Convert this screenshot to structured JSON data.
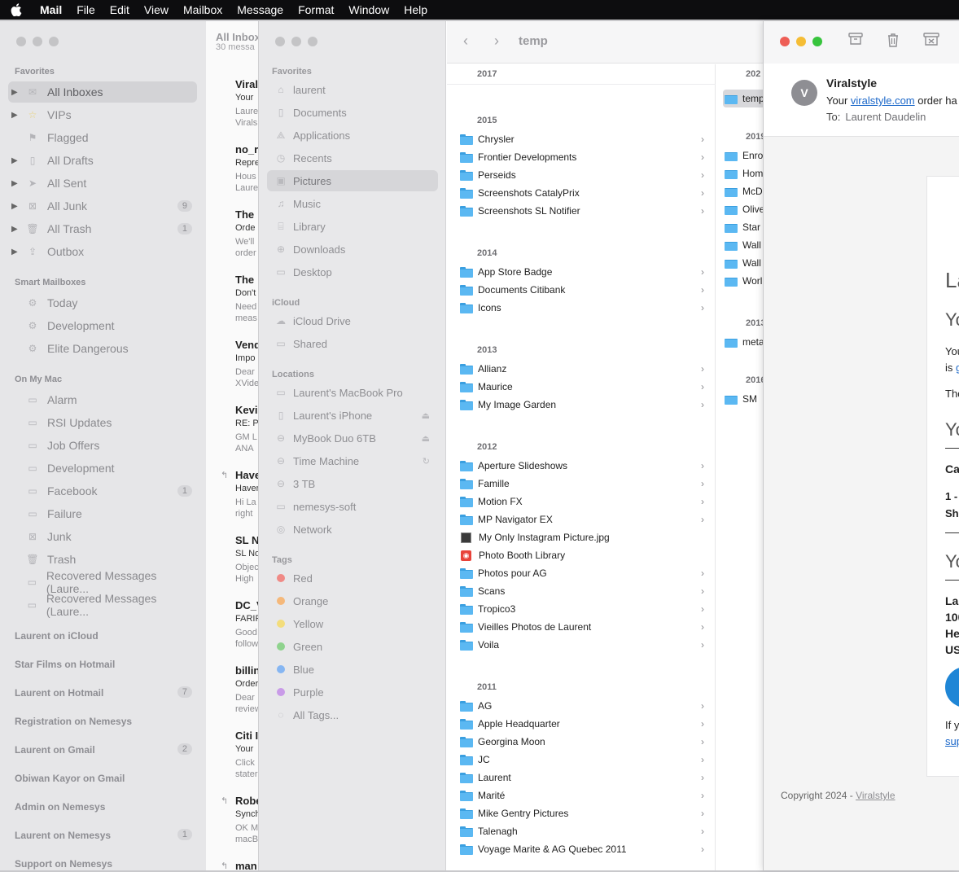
{
  "menubar": {
    "app": "Mail",
    "items": [
      "File",
      "Edit",
      "View",
      "Mailbox",
      "Message",
      "Format",
      "Window",
      "Help"
    ]
  },
  "mail_sidebar": {
    "favorites_title": "Favorites",
    "favorites": [
      {
        "label": "All Inboxes",
        "badge": ""
      },
      {
        "label": "VIPs",
        "badge": ""
      },
      {
        "label": "Flagged",
        "badge": ""
      },
      {
        "label": "All Drafts",
        "badge": ""
      },
      {
        "label": "All Sent",
        "badge": ""
      },
      {
        "label": "All Junk",
        "badge": "9"
      },
      {
        "label": "All Trash",
        "badge": "1"
      },
      {
        "label": "Outbox",
        "badge": ""
      }
    ],
    "smart_title": "Smart Mailboxes",
    "smart": [
      "Today",
      "Development",
      "Elite Dangerous"
    ],
    "onmymac_title": "On My Mac",
    "onmymac": [
      {
        "label": "Alarm",
        "badge": ""
      },
      {
        "label": "RSI Updates",
        "badge": ""
      },
      {
        "label": "Job Offers",
        "badge": ""
      },
      {
        "label": "Development",
        "badge": ""
      },
      {
        "label": "Facebook",
        "badge": "1"
      },
      {
        "label": "Failure",
        "badge": ""
      },
      {
        "label": "Junk",
        "badge": ""
      },
      {
        "label": "Trash",
        "badge": ""
      },
      {
        "label": "Recovered Messages (Laure...",
        "badge": ""
      },
      {
        "label": "Recovered Messages (Laure...",
        "badge": ""
      }
    ],
    "accounts": [
      {
        "label": "Laurent on iCloud",
        "badge": ""
      },
      {
        "label": "Star Films on Hotmail",
        "badge": ""
      },
      {
        "label": "Laurent on Hotmail",
        "badge": "7"
      },
      {
        "label": "Registration on Nemesys",
        "badge": ""
      },
      {
        "label": "Laurent on Gmail",
        "badge": "2"
      },
      {
        "label": "Obiwan Kayor on Gmail",
        "badge": ""
      },
      {
        "label": "Admin on Nemesys",
        "badge": ""
      },
      {
        "label": "Laurent on Nemesys",
        "badge": "1"
      },
      {
        "label": "Support on Nemesys",
        "badge": ""
      }
    ]
  },
  "message_list": {
    "title": "All Inbox",
    "subtitle": "30 messa",
    "messages": [
      {
        "from": "Viral",
        "l2": "Your",
        "l3a": "Laure",
        "l3b": "Virals"
      },
      {
        "from": "no_r",
        "l2": "Repre",
        "l3a": "Hous",
        "l3b": "Laure"
      },
      {
        "from": "The",
        "l2": "Orde",
        "l3a": "We'll",
        "l3b": "order"
      },
      {
        "from": "The",
        "l2": "Don't",
        "l3a": "Need",
        "l3b": "meas"
      },
      {
        "from": "Vend",
        "l2": "Impo",
        "l3a": "Dear",
        "l3b": "XVide"
      },
      {
        "from": "Kevi",
        "l2": "RE: P",
        "l3a": "GM L",
        "l3b": "ANA"
      },
      {
        "from": "Have",
        "l2": "Haver",
        "l3a": "Hi La",
        "l3b": "right"
      },
      {
        "from": "SL N",
        "l2": "SL No",
        "l3a": "Objec",
        "l3b": "High"
      },
      {
        "from": "DC_V",
        "l2": "FARIF",
        "l3a": "Good",
        "l3b": "follow"
      },
      {
        "from": "billin",
        "l2": "Order",
        "l3a": "Dear",
        "l3b": "review"
      },
      {
        "from": "Citi I",
        "l2": "Your",
        "l3a": "Click",
        "l3b": "stater"
      },
      {
        "from": "Robe",
        "l2": "Synch",
        "l3a": "OK M",
        "l3b": "macB"
      },
      {
        "from": "man",
        "l2": "",
        "l3a": "",
        "l3b": ""
      }
    ]
  },
  "finder": {
    "path": "temp",
    "favorites_title": "Favorites",
    "favorites": [
      "laurent",
      "Documents",
      "Applications",
      "Recents",
      "Pictures",
      "Music",
      "Library",
      "Downloads",
      "Desktop"
    ],
    "icloud_title": "iCloud",
    "icloud": [
      "iCloud Drive",
      "Shared"
    ],
    "locations_title": "Locations",
    "locations": [
      "Laurent's MacBook Pro",
      "Laurent's iPhone",
      "MyBook Duo 6TB",
      "Time Machine",
      "3 TB",
      "nemesys-soft",
      "Network"
    ],
    "tags_title": "Tags",
    "tags": [
      {
        "label": "Red",
        "color": "#f08a86"
      },
      {
        "label": "Orange",
        "color": "#f5b87a"
      },
      {
        "label": "Yellow",
        "color": "#f3dd7c"
      },
      {
        "label": "Green",
        "color": "#8fd38e"
      },
      {
        "label": "Blue",
        "color": "#86b6f2"
      },
      {
        "label": "Purple",
        "color": "#c99be8"
      },
      {
        "label": "All Tags...",
        "color": ""
      }
    ],
    "column1": {
      "y2017": "2017",
      "y2015": "2015",
      "items2015": [
        "Chrysler",
        "Frontier Developments",
        "Perseids",
        "Screenshots CatalyPrix",
        "Screenshots SL Notifier"
      ],
      "y2014": "2014",
      "items2014": [
        "App Store Badge",
        "Documents Citibank",
        "Icons"
      ],
      "y2013": "2013",
      "items2013": [
        "Allianz",
        "Maurice",
        "My Image Garden"
      ],
      "y2012": "2012",
      "items2012": [
        "Aperture Slideshows",
        "Famille",
        "Motion FX",
        "MP Navigator EX",
        "My Only Instagram Picture.jpg",
        "Photo Booth Library",
        "Photos pour AG",
        "Scans",
        "Tropico3",
        "Vieilles Photos de Laurent",
        "Voila"
      ],
      "y2011": "2011",
      "items2011": [
        "AG",
        "Apple Headquarter",
        "Georgina Moon",
        "JC",
        "Laurent",
        "Marité",
        "Mike Gentry Pictures",
        "Talenagh",
        "Voyage Marite & AG Quebec 2011"
      ]
    },
    "column2": {
      "y_a": "202",
      "selected": "temp",
      "y_b": "2019",
      "items_b": [
        "Enro",
        "Hom",
        "McD",
        "Olive",
        "Star",
        "Wall",
        "Wall",
        "Worl"
      ],
      "y_c": "2013",
      "items_c": [
        "meta"
      ],
      "y_d": "2016",
      "items_d": [
        "SM"
      ]
    }
  },
  "viewer": {
    "avatar_letter": "V",
    "sender": "Viralstyle",
    "subject_prefix": "Your ",
    "subject_link": "viralstyle.com",
    "subject_suffix": " order ha",
    "to_label": "To:",
    "to_name": "Laurent Daudelin",
    "body": {
      "f1": "La",
      "f2": "Yo",
      "f3": "You",
      "f4": "is",
      "f4link": "g",
      "f5": "The",
      "f6": "Yo",
      "f7": "Ca",
      "f8": "1 -",
      "f9": "Shi",
      "f10": "Yo",
      "f11": "La",
      "f12": "100",
      "f13": "He",
      "f14": "US",
      "f15": "If y",
      "f16": "sup"
    },
    "copyright_prefix": "Copyright 2024 - ",
    "copyright_link": "Viralstyle"
  }
}
